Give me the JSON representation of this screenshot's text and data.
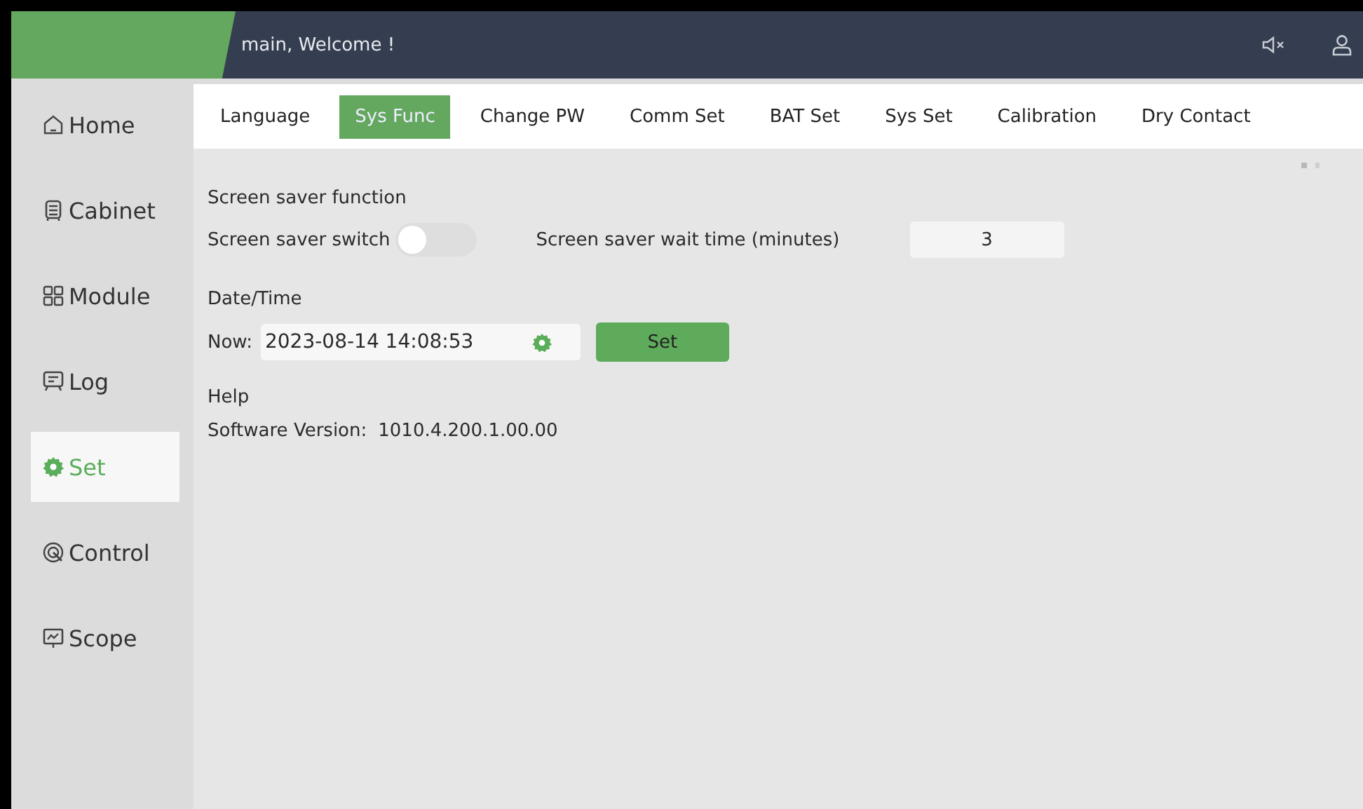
{
  "header": {
    "welcome": "main, Welcome !",
    "muted": true
  },
  "sidebar": {
    "items": [
      {
        "label": "Home",
        "selected": false
      },
      {
        "label": "Cabinet",
        "selected": false
      },
      {
        "label": "Module",
        "selected": false
      },
      {
        "label": "Log",
        "selected": false
      },
      {
        "label": "Set",
        "selected": true
      },
      {
        "label": "Control",
        "selected": false
      },
      {
        "label": "Scope",
        "selected": false
      }
    ]
  },
  "tabs": [
    {
      "label": "Language",
      "selected": false
    },
    {
      "label": "Sys Func",
      "selected": true
    },
    {
      "label": "Change PW",
      "selected": false
    },
    {
      "label": "Comm Set",
      "selected": false
    },
    {
      "label": "BAT Set",
      "selected": false
    },
    {
      "label": "Sys Set",
      "selected": false
    },
    {
      "label": "Calibration",
      "selected": false
    },
    {
      "label": "Dry Contact",
      "selected": false
    }
  ],
  "screen_saver": {
    "heading": "Screen saver function",
    "switch_label": "Screen saver switch",
    "switch_on": false,
    "wait_label": "Screen saver wait time (minutes)",
    "wait_value": "3"
  },
  "date_time": {
    "heading": "Date/Time",
    "now_label": "Now:",
    "value": "2023-08-14 14:08:53",
    "button": "Set"
  },
  "help": {
    "heading": "Help",
    "version_label": "Software Version:",
    "version": "1010.4.200.1.00.00"
  }
}
